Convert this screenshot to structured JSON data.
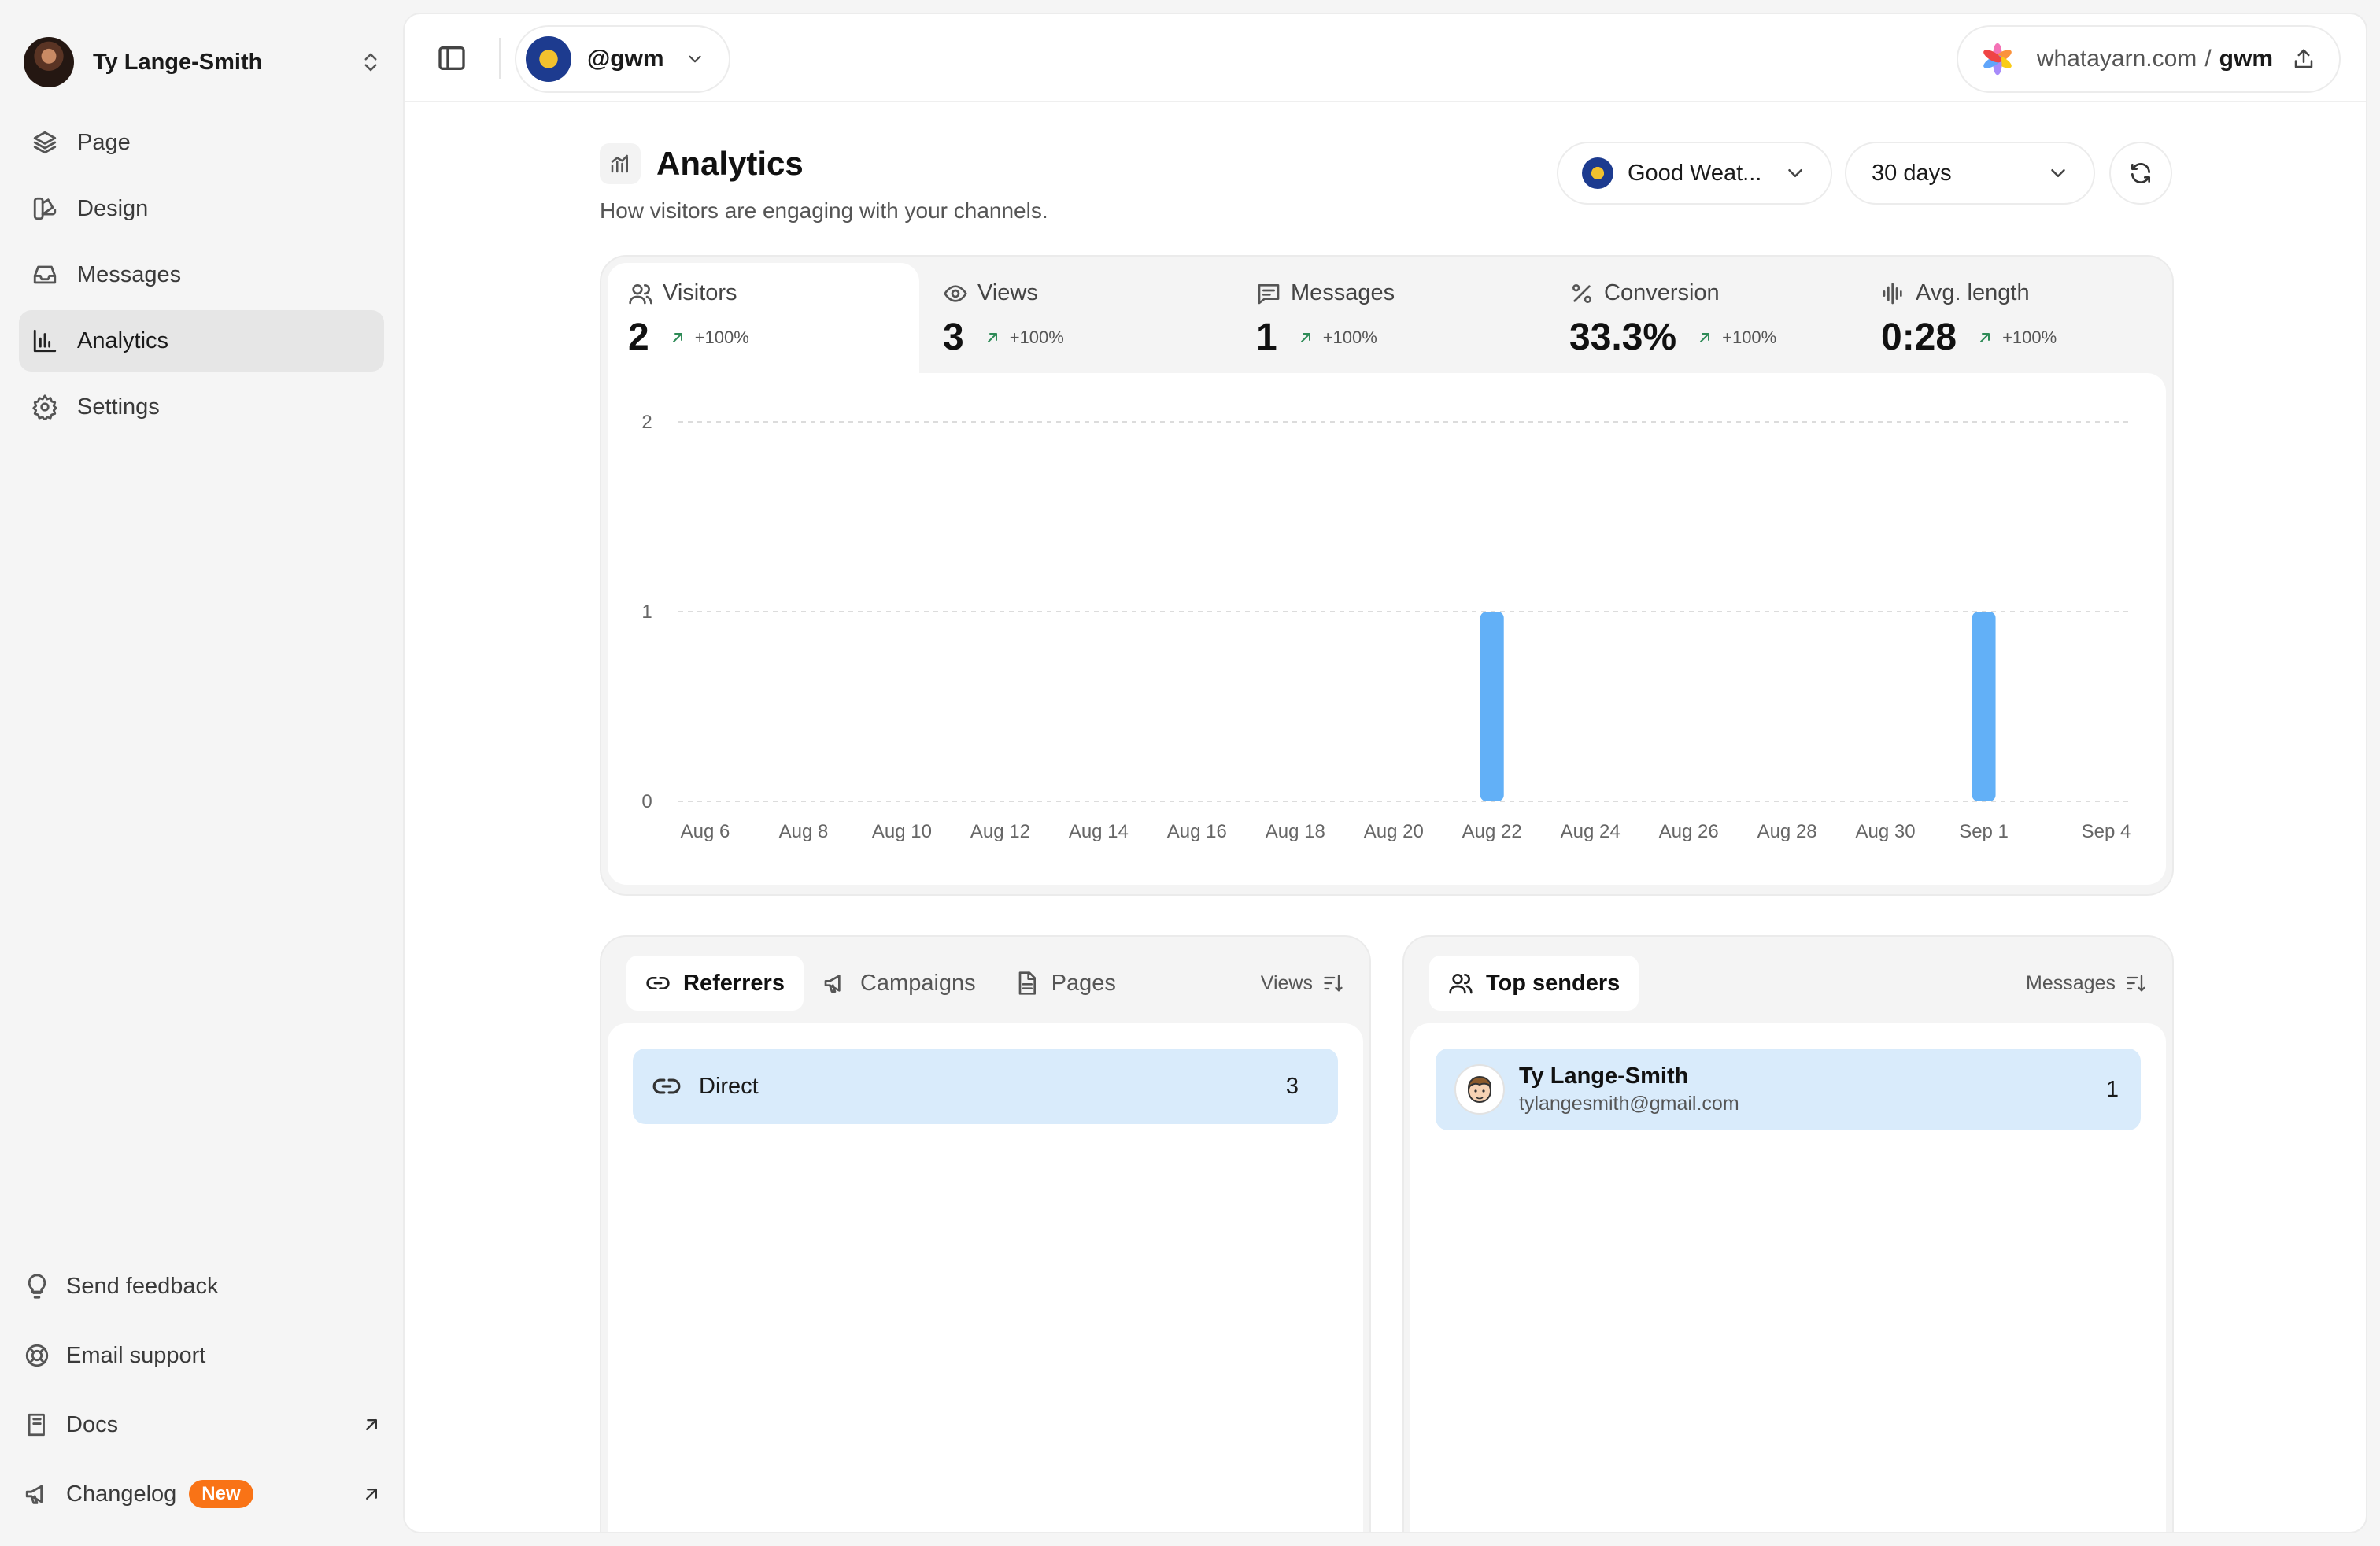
{
  "user": {
    "name": "Ty Lange-Smith"
  },
  "nav": {
    "items": [
      {
        "label": "Page",
        "icon": "layers-icon"
      },
      {
        "label": "Design",
        "icon": "palette-icon"
      },
      {
        "label": "Messages",
        "icon": "inbox-icon"
      },
      {
        "label": "Analytics",
        "icon": "bar-chart-icon",
        "active": true
      },
      {
        "label": "Settings",
        "icon": "gear-icon"
      }
    ],
    "bottom": [
      {
        "label": "Send feedback",
        "icon": "lightbulb-icon"
      },
      {
        "label": "Email support",
        "icon": "lifebuoy-icon"
      },
      {
        "label": "Docs",
        "icon": "book-icon"
      },
      {
        "label": "Changelog",
        "icon": "megaphone-icon",
        "badge": "New"
      }
    ]
  },
  "topbar": {
    "channel": "@gwm",
    "domain_host": "whatayarn.com",
    "domain_sep": "/",
    "domain_user": "gwm"
  },
  "header": {
    "title": "Analytics",
    "subtitle": "How visitors are engaging with your channels."
  },
  "filters": {
    "channel": "Good Weat...",
    "range": "30 days"
  },
  "stats": [
    {
      "label": "Visitors",
      "value": "2",
      "change": "+100%",
      "active": true
    },
    {
      "label": "Views",
      "value": "3",
      "change": "+100%"
    },
    {
      "label": "Messages",
      "value": "1",
      "change": "+100%"
    },
    {
      "label": "Conversion",
      "value": "33.3%",
      "change": "+100%"
    },
    {
      "label": "Avg. length",
      "value": "0:28",
      "change": "+100%"
    }
  ],
  "colors": {
    "bar": "#62b0f7",
    "accent_green": "#2e8b57",
    "badge": "#f97316",
    "row_highlight": "#d9ebfb"
  },
  "chart_data": {
    "type": "bar",
    "x_ticks": [
      "Aug 6",
      "Aug 8",
      "Aug 10",
      "Aug 12",
      "Aug 14",
      "Aug 16",
      "Aug 18",
      "Aug 20",
      "Aug 22",
      "Aug 24",
      "Aug 26",
      "Aug 28",
      "Aug 30",
      "Sep 1",
      "Sep 4"
    ],
    "categories": [
      "Aug 22",
      "Sep 1"
    ],
    "values": [
      1,
      1
    ],
    "y_ticks": [
      0,
      1,
      2
    ],
    "ylim": [
      0,
      2
    ],
    "grid": true
  },
  "referrers": {
    "tabs": [
      "Referrers",
      "Campaigns",
      "Pages"
    ],
    "sort_label": "Views",
    "rows": [
      {
        "name": "Direct",
        "count": "3"
      }
    ]
  },
  "senders": {
    "tab": "Top senders",
    "sort_label": "Messages",
    "rows": [
      {
        "name": "Ty Lange-Smith",
        "email": "tylangesmith@gmail.com",
        "count": "1"
      }
    ]
  }
}
